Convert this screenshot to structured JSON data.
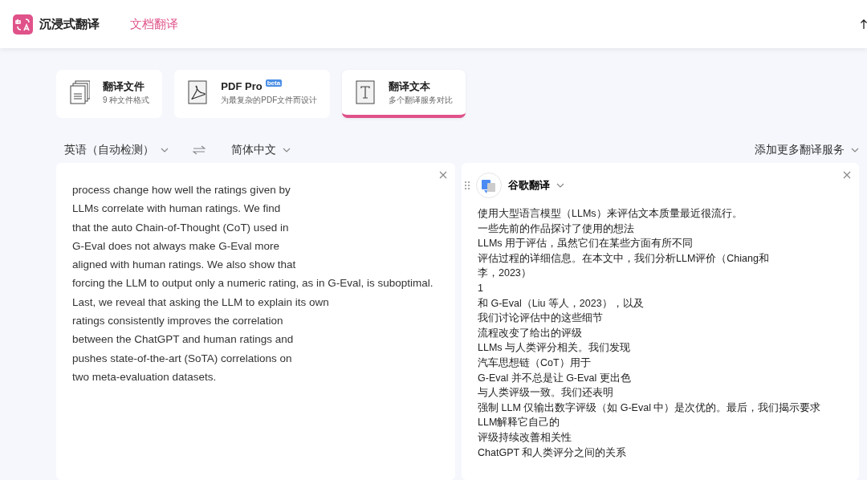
{
  "header": {
    "app_name": "沉浸式翻译",
    "nav": [
      {
        "label": "文档翻译",
        "selected": true
      }
    ]
  },
  "mode_cards": [
    {
      "kind": "files",
      "title": "翻译文件",
      "subtitle": "9 种文件格式",
      "selected": false
    },
    {
      "kind": "pdf",
      "title": "PDF Pro",
      "badge": "beta",
      "subtitle": "为最复杂的PDF文件而设计",
      "selected": false
    },
    {
      "kind": "text",
      "title": "翻译文本",
      "subtitle": "多个翻译服务对比",
      "selected": true
    }
  ],
  "languages": {
    "source": "英语（自动检测）",
    "target": "简体中文"
  },
  "add_services": "添加更多翻译服务",
  "source_panel": {
    "lines": [
      "process change how well the ratings given by",
      "LLMs correlate with human ratings. We find",
      "that the auto Chain-of-Thought (CoT) used in",
      "G-Eval does not always make G-Eval more",
      "aligned with human ratings. We also show that",
      "forcing the LLM to output only a numeric rating, as in G-Eval, is suboptimal.",
      "Last, we reveal that asking the LLM to explain its own",
      "ratings consistently improves the correlation",
      "between the ChatGPT and human ratings and",
      "pushes state-of-the-art (SoTA) correlations on",
      "two meta-evaluation datasets."
    ]
  },
  "result_panel": {
    "service": "谷歌翻译",
    "lines": [
      "使用大型语言模型（LLMs）来评估文本质量最近很流行。",
      "一些先前的作品探讨了使用的想法",
      "LLMs 用于评估，虽然它们在某些方面有所不同",
      "评估过程的详细信息。在本文中，我们分析LLM评价（Chiang和",
      "李，2023）",
      "1",
      "和 G-Eval（Liu 等人，2023），以及",
      "我们讨论评估中的这些细节",
      "流程改变了给出的评级",
      "LLMs 与人类评分相关。我们发现",
      "汽车思想链（CoT）用于",
      "G-Eval 并不总是让 G-Eval 更出色",
      "与人类评级一致。我们还表明",
      "强制 LLM 仅输出数字评级（如 G-Eval 中）是次优的。最后，我们揭示要求",
      "LLM解释它自己的",
      "评级持续改善相关性",
      "ChatGPT 和人类评分之间的关系"
    ]
  }
}
